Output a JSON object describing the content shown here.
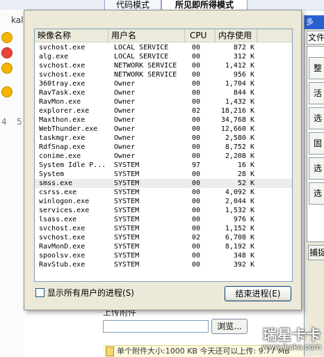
{
  "background": {
    "tabs": [
      "代码模式",
      "所见即所得模式"
    ],
    "left_user": "kal",
    "left_numbers": [
      "4",
      "5"
    ],
    "upload_label": "上传附件",
    "browse_label": "浏览...",
    "bottom_info": "单个附件大小:1000 KB  今天还可以上传: 9.77 MB",
    "watermark": {
      "title": "瑞星卡卡",
      "url": "www.ikaka.com"
    }
  },
  "right_window": {
    "title": "多",
    "tab": "文件",
    "buttons": [
      "整",
      "活",
      "选",
      "固",
      "选",
      "选"
    ],
    "capture": "捕捉"
  },
  "dialog": {
    "columns": {
      "name": "映像名称",
      "user": "用户名",
      "cpu": "CPU",
      "mem": "内存使用"
    },
    "processes": [
      {
        "name": "svchost.exe",
        "user": "LOCAL SERVICE",
        "cpu": "00",
        "mem": "872 K"
      },
      {
        "name": "alg.exe",
        "user": "LOCAL SERVICE",
        "cpu": "00",
        "mem": "312 K"
      },
      {
        "name": "svchost.exe",
        "user": "NETWORK SERVICE",
        "cpu": "00",
        "mem": "1,412 K"
      },
      {
        "name": "svchost.exe",
        "user": "NETWORK SERVICE",
        "cpu": "00",
        "mem": "956 K"
      },
      {
        "name": "360tray.exe",
        "user": "Owner",
        "cpu": "00",
        "mem": "1,704 K"
      },
      {
        "name": "RavTask.exe",
        "user": "Owner",
        "cpu": "00",
        "mem": "844 K"
      },
      {
        "name": "RavMon.exe",
        "user": "Owner",
        "cpu": "00",
        "mem": "1,432 K"
      },
      {
        "name": "explorer.exe",
        "user": "Owner",
        "cpu": "02",
        "mem": "18,216 K"
      },
      {
        "name": "Maxthon.exe",
        "user": "Owner",
        "cpu": "00",
        "mem": "34,768 K"
      },
      {
        "name": "WebThunder.exe",
        "user": "Owner",
        "cpu": "00",
        "mem": "12,660 K"
      },
      {
        "name": "taskmgr.exe",
        "user": "Owner",
        "cpu": "00",
        "mem": "2,580 K"
      },
      {
        "name": "RdfSnap.exe",
        "user": "Owner",
        "cpu": "00",
        "mem": "8,752 K"
      },
      {
        "name": "conime.exe",
        "user": "Owner",
        "cpu": "00",
        "mem": "2,208 K"
      },
      {
        "name": "System Idle P...",
        "user": "SYSTEM",
        "cpu": "97",
        "mem": "16 K"
      },
      {
        "name": "System",
        "user": "SYSTEM",
        "cpu": "00",
        "mem": "28 K"
      },
      {
        "name": "smss.exe",
        "user": "SYSTEM",
        "cpu": "00",
        "mem": "52 K"
      },
      {
        "name": "csrss.exe",
        "user": "SYSTEM",
        "cpu": "00",
        "mem": "4,092 K"
      },
      {
        "name": "winlogon.exe",
        "user": "SYSTEM",
        "cpu": "00",
        "mem": "2,044 K"
      },
      {
        "name": "services.exe",
        "user": "SYSTEM",
        "cpu": "00",
        "mem": "1,532 K"
      },
      {
        "name": "lsass.exe",
        "user": "SYSTEM",
        "cpu": "00",
        "mem": "976 K"
      },
      {
        "name": "svchost.exe",
        "user": "SYSTEM",
        "cpu": "00",
        "mem": "1,152 K"
      },
      {
        "name": "svchost.exe",
        "user": "SYSTEM",
        "cpu": "02",
        "mem": "6,708 K"
      },
      {
        "name": "RavMonD.exe",
        "user": "SYSTEM",
        "cpu": "00",
        "mem": "8,192 K"
      },
      {
        "name": "spoolsv.exe",
        "user": "SYSTEM",
        "cpu": "00",
        "mem": "348 K"
      },
      {
        "name": "RavStub.exe",
        "user": "SYSTEM",
        "cpu": "00",
        "mem": "392 K"
      }
    ],
    "selected_row": "smss.exe",
    "show_all_label": "显示所有用户的进程(S)",
    "show_all_checked": false,
    "end_process_label": "结束进程(E)"
  }
}
